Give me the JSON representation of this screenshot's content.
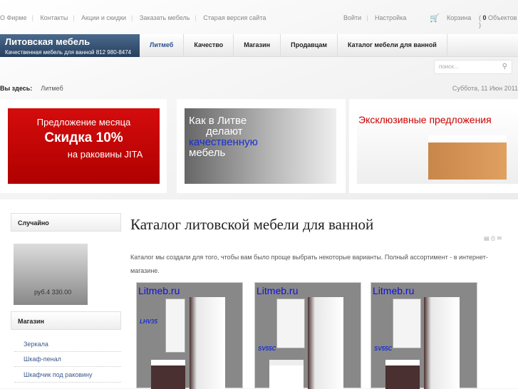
{
  "topbar": {
    "links": [
      "О Фирме",
      "Контакты",
      "Акции и скидки",
      "Заказать мебель",
      "Старая версия сайта"
    ],
    "login": "Войти",
    "settings": "Настройка",
    "cart_label": "Корзина",
    "cart_count_prefix": "(",
    "cart_count": "0",
    "cart_count_suffix": "Объектов )"
  },
  "logo": {
    "title": "Литовская мебель",
    "subtitle": "Качественная мебель для ванной 812 980-8474"
  },
  "nav": [
    "Литмеб",
    "Качество",
    "Магазин",
    "Продавцам",
    "Каталог мебели для ванной"
  ],
  "search": {
    "placeholder": "поиск..."
  },
  "breadcrumb": {
    "label": "Вы здесь:",
    "current": "Литмеб"
  },
  "date": "Суббота, 11 Июн 2011",
  "banners": [
    {
      "line1": "Предложение месяца",
      "line2": "Скидка 10%",
      "line3": "на раковины JITA"
    },
    {
      "line1": "Как в Литве",
      "line2": "делают",
      "line3": "качественную",
      "line4": "мебель"
    },
    {
      "line1": "Эксклюзивные предложения"
    }
  ],
  "sidebar": {
    "random_title": "Случайно",
    "random_price": "руб.4 330.00",
    "shop_title": "Магазин",
    "shop_items": [
      "Зеркала",
      "Шкаф-пенал",
      "Шкафчик под раковину"
    ]
  },
  "article": {
    "title": "Каталог литовской мебели для ванной",
    "intro": "Каталог мы создали для того, чтобы вам было проще выбрать некоторые варианты. Полный ассортимент - в интернет-магазине.",
    "products": [
      {
        "watermark": "Litmeb.ru",
        "code": "LHV35"
      },
      {
        "watermark": "Litmeb.ru",
        "code": "SV55C"
      },
      {
        "watermark": "Litmeb.ru",
        "code": "SV55C"
      }
    ]
  }
}
